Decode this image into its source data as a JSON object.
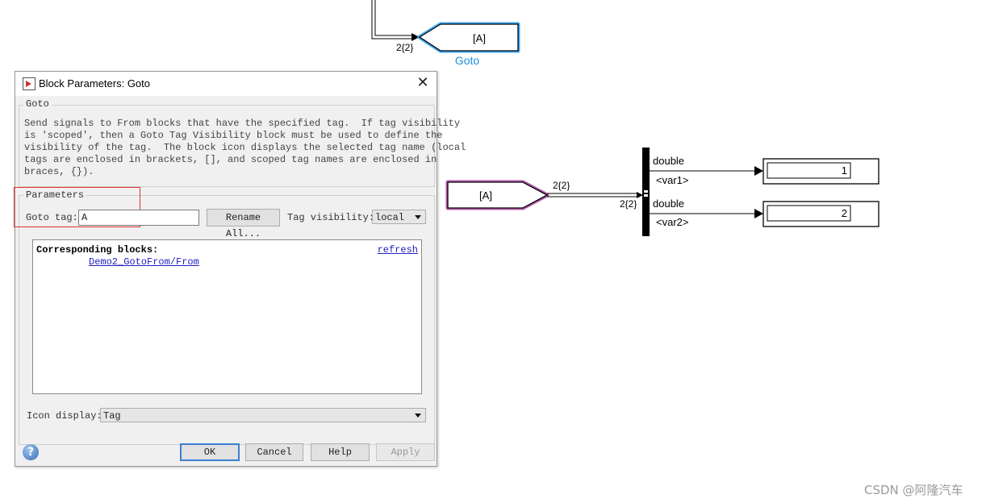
{
  "model": {
    "top_goto": {
      "tag_text": "[A]",
      "name": "Goto",
      "signal_dim": "2{2}"
    },
    "from_block": {
      "tag_text": "[A]",
      "signal_dim": "2{2}"
    },
    "demux": {
      "input_dim": "2{2}"
    },
    "outputs": [
      {
        "type_label": "double",
        "signal_name": "<var1>",
        "display_value": "1"
      },
      {
        "type_label": "double",
        "signal_name": "<var2>",
        "display_value": "2"
      }
    ],
    "colors": {
      "goto_highlight": "#3fa9f5",
      "from_highlight": "#b45aa8",
      "goto_name": "#1e90d8"
    }
  },
  "dialog": {
    "title": "Block Parameters: Goto",
    "close_glyph": "✕",
    "group_label": "Goto",
    "description": "Send signals to From blocks that have the specified tag.  If tag visibility\nis 'scoped', then a Goto Tag Visibility block must be used to define the\nvisibility of the tag.  The block icon displays the selected tag name (local\ntags are enclosed in brackets, [], and scoped tag names are enclosed in\nbraces, {}).",
    "parameters_label": "Parameters",
    "goto_tag_label": "Goto tag:",
    "goto_tag_value": "A",
    "rename_all_label": "Rename All...",
    "tag_visibility_label": "Tag visibility:",
    "tag_visibility_value": "local",
    "corresponding_blocks_label": "Corresponding blocks:",
    "corresponding_block_link": "Demo2_GotoFrom/From",
    "refresh_label": "refresh",
    "icon_display_label": "Icon display:",
    "icon_display_value": "Tag",
    "help_icon_glyph": "?",
    "buttons": {
      "ok": "OK",
      "cancel": "Cancel",
      "help": "Help",
      "apply": "Apply"
    }
  },
  "watermark": "CSDN @阿隆汽车"
}
